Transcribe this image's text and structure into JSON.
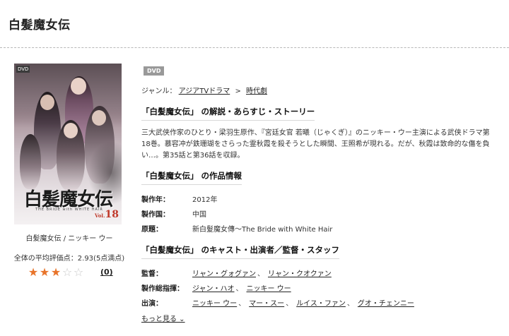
{
  "page": {
    "title": "白髪魔女伝"
  },
  "product": {
    "cover_badge": "DVD",
    "cover_logo": "白髪魔女伝",
    "cover_logo_sub": "THE BRIDE with WHITE HAIR",
    "cover_volume": "18",
    "cover_volume_prefix": "Vol.",
    "caption": "白髪魔女伝 / ニッキー ウー",
    "rating_label": "全体の平均評価点：2.93(5点満点)",
    "rating_value": 2.93,
    "rating_max": 5,
    "stars": [
      "★",
      "★",
      "★",
      "☆",
      "☆"
    ],
    "review_count": "(0)"
  },
  "main": {
    "format_badge": "DVD",
    "genre_label": "ジャンル：",
    "genres": [
      "アジアTVドラマ",
      "時代劇"
    ],
    "genre_sep": ">",
    "synopsis_title": "「白髪魔女伝」 の解説・あらすじ・ストーリー",
    "synopsis": "三大武侠作家のひとり・梁羽生原作、『宮廷女官 若曦（じゃくぎ）』のニッキー・ウー主演による武侠ドラマ第18巻。慕容冲が鉄珊瑚をさらった霊秋霞を殺そうとした瞬間、王照希が現れる。だが、秋霞は致命的な傷を負い…。第35話と第36話を収録。",
    "info_title": "「白髪魔女伝」 の作品情報",
    "info": [
      {
        "key": "製作年：",
        "value": "2012年"
      },
      {
        "key": "製作国：",
        "value": "中国"
      },
      {
        "key": "原題：",
        "value": "新白髮魔女傳～The Bride with White Hair"
      }
    ],
    "cast_title": "「白髪魔女伝」 のキャスト・出演者／監督・スタッフ",
    "cast": [
      {
        "key": "監督：",
        "names": [
          "リャン・グォグァン",
          "リャン・クオクァン"
        ]
      },
      {
        "key": "製作総指揮：",
        "names": [
          "ジャン・ハオ",
          "ニッキー ウー"
        ]
      },
      {
        "key": "出演：",
        "names": [
          "ニッキー ウー",
          "マー・スー",
          "ルイス・ファン",
          "グオ・チェンニー"
        ]
      }
    ],
    "more_link": "もっと見る ⌄",
    "comma": "、"
  },
  "colors": {
    "star_on": "#e8742a",
    "star_off": "#c9c9c9",
    "badge_bg": "#999999"
  }
}
